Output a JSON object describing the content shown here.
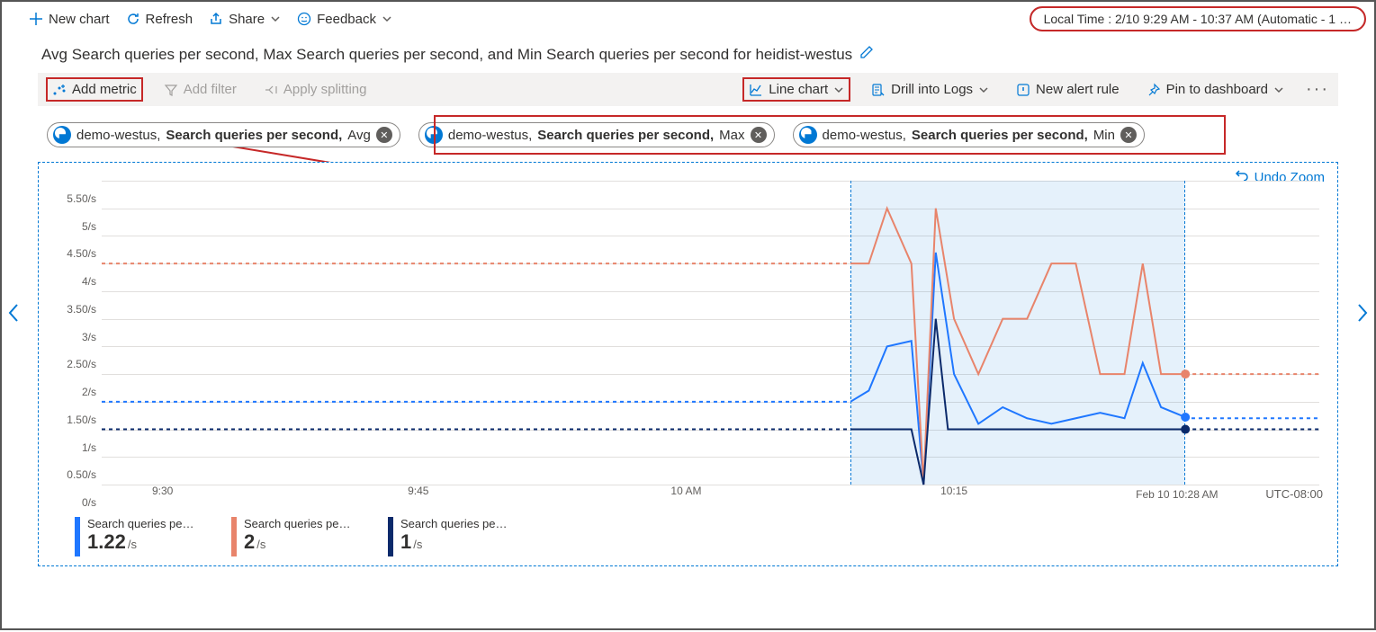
{
  "toolbar": {
    "new_chart": "New chart",
    "refresh": "Refresh",
    "share": "Share",
    "feedback": "Feedback",
    "time_range": "Local Time : 2/10 9:29 AM - 10:37 AM (Automatic - 1 …"
  },
  "chart_title": "Avg Search queries per second, Max Search queries per second, and Min Search queries per second for heidist-westus",
  "chart_toolbar": {
    "add_metric": "Add metric",
    "add_filter": "Add filter",
    "apply_splitting": "Apply splitting",
    "chart_type": "Line chart",
    "drill_logs": "Drill into Logs",
    "new_alert": "New alert rule",
    "pin_dashboard": "Pin to dashboard"
  },
  "metric_pills": [
    {
      "resource": "demo-westus,",
      "metric": "Search queries per second,",
      "agg": "Avg"
    },
    {
      "resource": "demo-westus,",
      "metric": "Search queries per second,",
      "agg": "Max"
    },
    {
      "resource": "demo-westus,",
      "metric": "Search queries per second,",
      "agg": "Min"
    }
  ],
  "undo_zoom": "Undo Zoom",
  "timezone": "UTC-08:00",
  "end_time_label": "Feb 10 10:28 AM",
  "legend": [
    {
      "label": "Search queries per s...",
      "value": "1.22",
      "unit": "/s",
      "color": "#1f77ff"
    },
    {
      "label": "Search queries per s...",
      "value": "2",
      "unit": "/s",
      "color": "#e8846b"
    },
    {
      "label": "Search queries per s...",
      "value": "1",
      "unit": "/s",
      "color": "#0b2a6b"
    }
  ],
  "chart_data": {
    "type": "line",
    "title": "Search queries per second",
    "ylabel": "/s",
    "y_ticks": [
      "0/s",
      "0.50/s",
      "1/s",
      "1.50/s",
      "2/s",
      "2.50/s",
      "3/s",
      "3.50/s",
      "4/s",
      "4.50/s",
      "5/s",
      "5.50/s"
    ],
    "ylim": [
      0,
      5.5
    ],
    "x_ticks": [
      "9:30",
      "9:45",
      "10 AM",
      "10:15"
    ],
    "x_tick_fractions": [
      0.05,
      0.26,
      0.48,
      0.7
    ],
    "zoom_region": {
      "start_frac": 0.615,
      "end_frac": 0.89
    },
    "series": [
      {
        "name": "Avg",
        "color": "#1f77ff",
        "baseline_before": 1.5,
        "baseline_after": 1.2,
        "points": [
          {
            "xf": 0.615,
            "y": 1.5
          },
          {
            "xf": 0.63,
            "y": 1.7
          },
          {
            "xf": 0.645,
            "y": 2.5
          },
          {
            "xf": 0.665,
            "y": 2.6
          },
          {
            "xf": 0.675,
            "y": 0.0
          },
          {
            "xf": 0.685,
            "y": 4.2
          },
          {
            "xf": 0.7,
            "y": 2.0
          },
          {
            "xf": 0.72,
            "y": 1.1
          },
          {
            "xf": 0.74,
            "y": 1.4
          },
          {
            "xf": 0.76,
            "y": 1.2
          },
          {
            "xf": 0.78,
            "y": 1.1
          },
          {
            "xf": 0.8,
            "y": 1.2
          },
          {
            "xf": 0.82,
            "y": 1.3
          },
          {
            "xf": 0.84,
            "y": 1.2
          },
          {
            "xf": 0.855,
            "y": 2.2
          },
          {
            "xf": 0.87,
            "y": 1.4
          },
          {
            "xf": 0.89,
            "y": 1.22
          }
        ]
      },
      {
        "name": "Max",
        "color": "#e8846b",
        "baseline_before": 4.0,
        "baseline_after": 2.0,
        "points": [
          {
            "xf": 0.615,
            "y": 4.0
          },
          {
            "xf": 0.63,
            "y": 4.0
          },
          {
            "xf": 0.645,
            "y": 5.0
          },
          {
            "xf": 0.665,
            "y": 4.0
          },
          {
            "xf": 0.675,
            "y": 0.0
          },
          {
            "xf": 0.685,
            "y": 5.0
          },
          {
            "xf": 0.7,
            "y": 3.0
          },
          {
            "xf": 0.72,
            "y": 2.0
          },
          {
            "xf": 0.74,
            "y": 3.0
          },
          {
            "xf": 0.76,
            "y": 3.0
          },
          {
            "xf": 0.78,
            "y": 4.0
          },
          {
            "xf": 0.8,
            "y": 4.0
          },
          {
            "xf": 0.82,
            "y": 2.0
          },
          {
            "xf": 0.84,
            "y": 2.0
          },
          {
            "xf": 0.855,
            "y": 4.0
          },
          {
            "xf": 0.87,
            "y": 2.0
          },
          {
            "xf": 0.89,
            "y": 2.0
          }
        ]
      },
      {
        "name": "Min",
        "color": "#0b2a6b",
        "baseline_before": 1.0,
        "baseline_after": 1.0,
        "points": [
          {
            "xf": 0.615,
            "y": 1.0
          },
          {
            "xf": 0.665,
            "y": 1.0
          },
          {
            "xf": 0.675,
            "y": 0.0
          },
          {
            "xf": 0.685,
            "y": 3.0
          },
          {
            "xf": 0.695,
            "y": 1.0
          },
          {
            "xf": 0.89,
            "y": 1.0
          }
        ]
      }
    ]
  }
}
